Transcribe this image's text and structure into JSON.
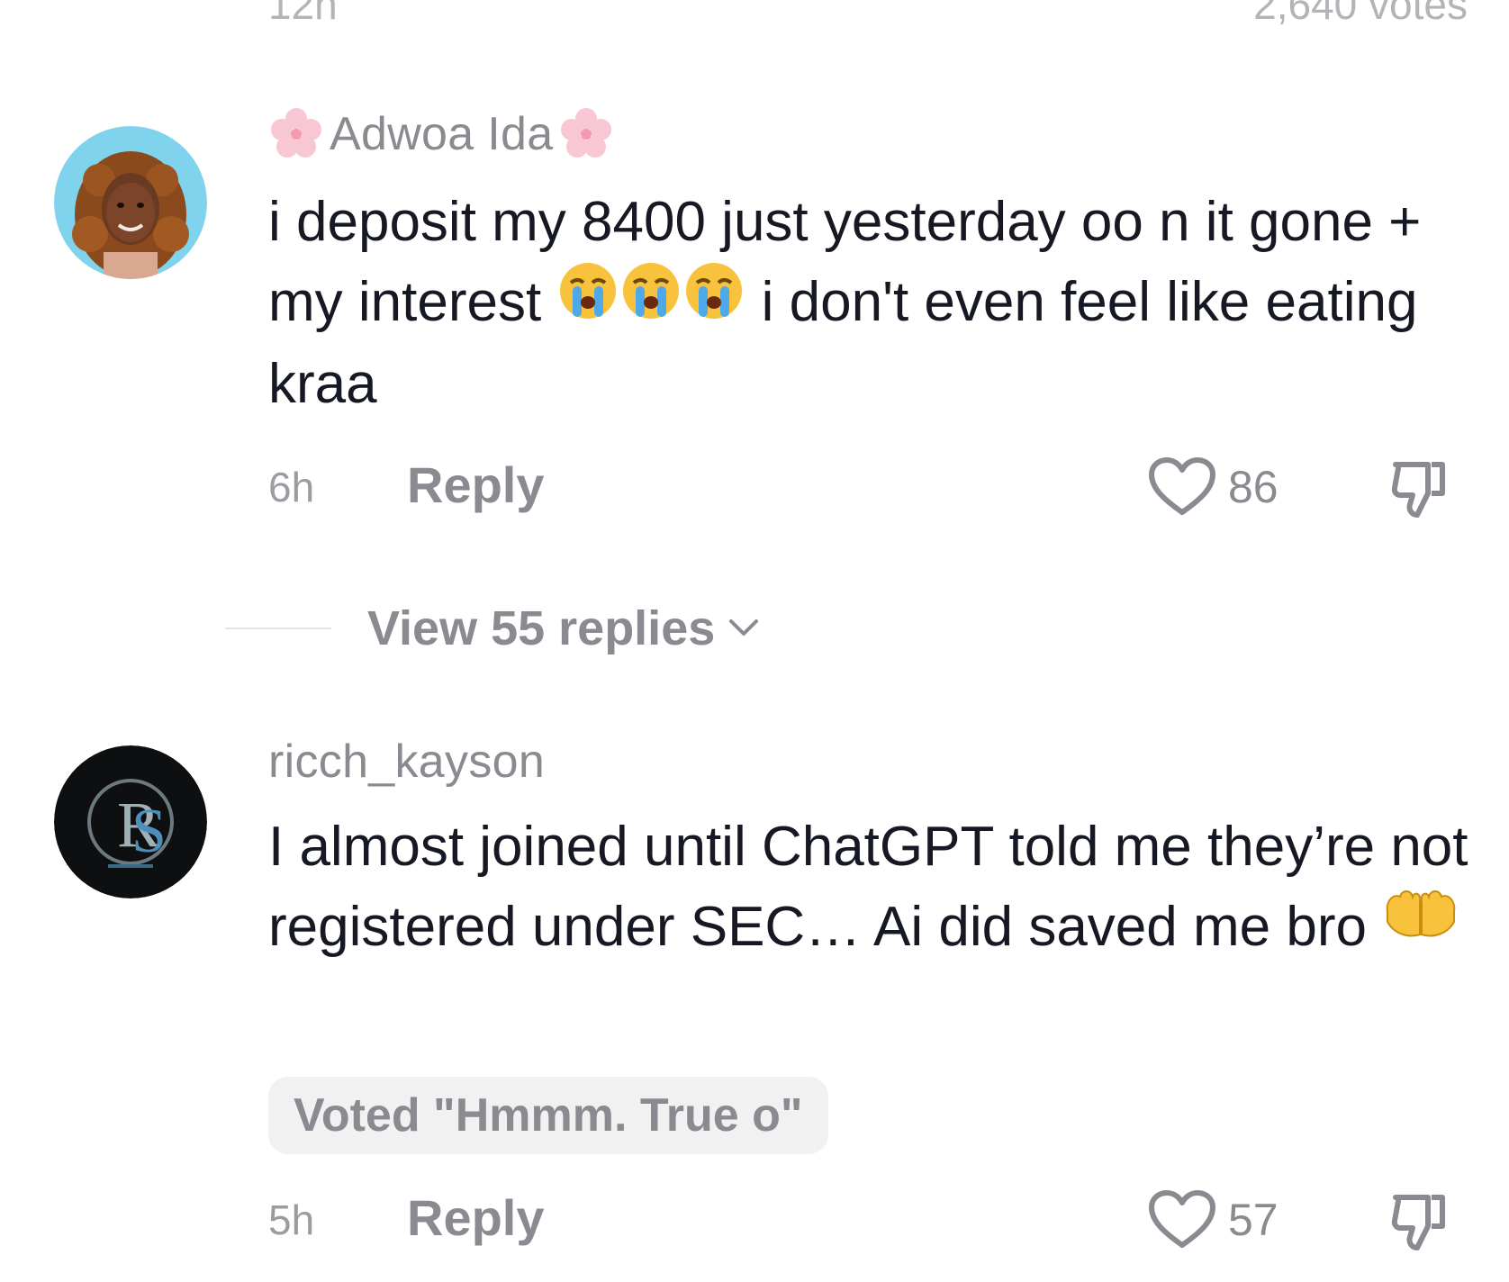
{
  "top": {
    "time": "12h",
    "votes": "2,640 votes"
  },
  "comments": [
    {
      "username": "Adwoa Ida",
      "username_decor": "cherry-blossom-icon",
      "text_parts": [
        "i deposit my 8400 just yesterday oo n it gone + my interest",
        "i don't even feel like eating kraa"
      ],
      "emojis": [
        "loudly-crying-face-icon",
        "loudly-crying-face-icon",
        "loudly-crying-face-icon"
      ],
      "time": "6h",
      "reply_label": "Reply",
      "likes": "86",
      "view_replies": "View 55 replies"
    },
    {
      "username": "ricch_kayson",
      "text": "I almost joined until ChatGPT told me they’re not registered under SEC… Ai did saved me bro",
      "emoji": "palms-up-together-icon",
      "vote_badge": "Voted \"Hmmm. True o\"",
      "time": "5h",
      "reply_label": "Reply",
      "likes": "57"
    }
  ],
  "colors": {
    "text_primary": "#161823",
    "text_secondary": "#8a8b91",
    "pill_bg": "#f1f1f2",
    "avatar1_bg": "#7fd3ec",
    "avatar2_bg": "#0d0f10"
  }
}
